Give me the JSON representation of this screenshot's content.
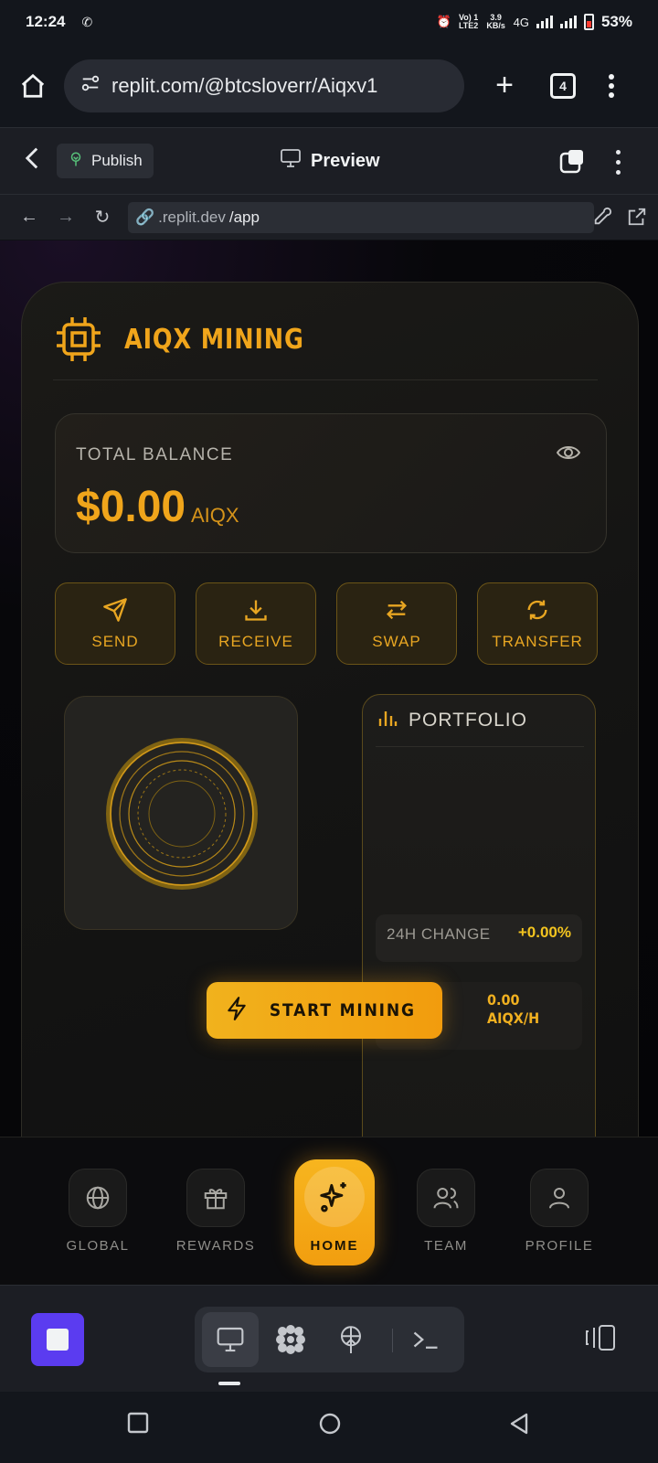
{
  "status_bar": {
    "time": "12:24",
    "net1": "Vo) 1 LTE2",
    "speed": "3.9 KB/s",
    "net_type": "4G",
    "battery": "53%"
  },
  "browser": {
    "url": "replit.com/@btcsloverr/Aiqxv1",
    "tab_count": "4"
  },
  "replit_header": {
    "publish_label": "Publish",
    "preview_label": "Preview"
  },
  "webview": {
    "address_domain": ".replit.dev",
    "address_path": "/app"
  },
  "app": {
    "brand_title": "AIQX MINING",
    "balance": {
      "label": "TOTAL BALANCE",
      "amount": "$0.00",
      "unit": "AIQX"
    },
    "actions": [
      {
        "label": "SEND",
        "icon": "send-icon"
      },
      {
        "label": "RECEIVE",
        "icon": "download-icon"
      },
      {
        "label": "SWAP",
        "icon": "swap-icon"
      },
      {
        "label": "TRANSFER",
        "icon": "refresh-icon"
      }
    ],
    "portfolio": {
      "title": "PORTFOLIO",
      "change_label": "24H CHANGE",
      "change_value": "+0.00%",
      "rate_value": "0.00 AIQX/H"
    },
    "start_mining_label": "START MINING",
    "nav": [
      {
        "label": "GLOBAL",
        "icon": "globe-icon"
      },
      {
        "label": "REWARDS",
        "icon": "gift-icon"
      },
      {
        "label": "HOME",
        "icon": "sparkles-icon",
        "active": true
      },
      {
        "label": "TEAM",
        "icon": "users-icon"
      },
      {
        "label": "PROFILE",
        "icon": "user-icon"
      }
    ]
  },
  "colors": {
    "accent": "#f0a51b",
    "stop_button": "#5b3cf0",
    "change_positive": "#f3c41f"
  }
}
